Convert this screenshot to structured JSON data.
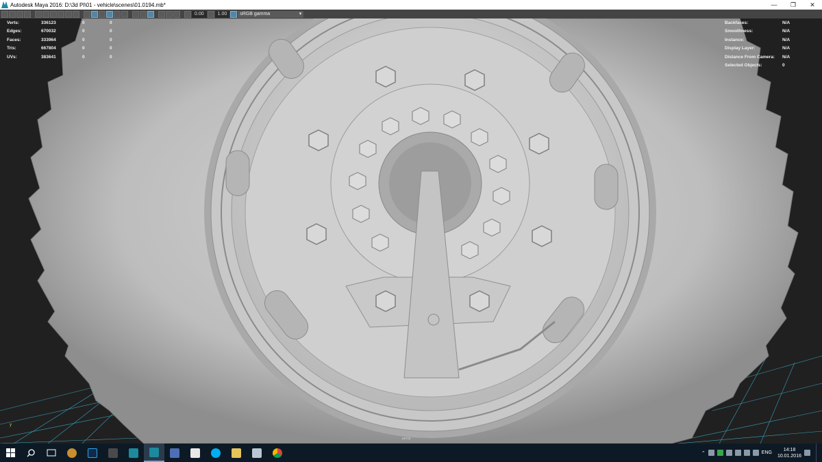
{
  "window": {
    "title": "Autodesk Maya 2016: D:\\3d PI\\01 - vehicle\\scenes\\01.0194.mb*",
    "minimize": "—",
    "restore": "❐",
    "close": "✕"
  },
  "toolbar": {
    "field_1": "0.00",
    "field_2": "1.00",
    "color_space": "sRGB gamma"
  },
  "hud_left": [
    {
      "label": "Verts:",
      "v1": "336123",
      "v2": "0",
      "v3": "0"
    },
    {
      "label": "Edges:",
      "v1": "670032",
      "v2": "0",
      "v3": "0"
    },
    {
      "label": "Faces:",
      "v1": "333964",
      "v2": "0",
      "v3": "0"
    },
    {
      "label": "Tris:",
      "v1": "667804",
      "v2": "0",
      "v3": "0"
    },
    {
      "label": "UVs:",
      "v1": "383641",
      "v2": "0",
      "v3": "0"
    }
  ],
  "hud_right": [
    {
      "label": "Backfaces:",
      "value": "N/A"
    },
    {
      "label": "Smoothness:",
      "value": "N/A"
    },
    {
      "label": "Instance:",
      "value": "N/A"
    },
    {
      "label": "Display Layer:",
      "value": "N/A"
    },
    {
      "label": "Distance From Camera:",
      "value": "N/A"
    },
    {
      "label": "Selected Objects:",
      "value": "0"
    }
  ],
  "viewport": {
    "camera": "persp",
    "axis": "y",
    "grid_color": "#3fc6e8",
    "background": "#202020"
  },
  "taskbar": {
    "apps": [
      "start-icon",
      "search-icon",
      "task-view-icon",
      "paint-icon",
      "photoshop-icon",
      "zbrush-icon",
      "maya-icon",
      "maya-active-icon",
      "save-icon",
      "book-icon",
      "skype-icon",
      "explorer-icon",
      "files-icon",
      "chrome-icon"
    ],
    "language": "ENG",
    "time": "14:18",
    "date": "10.01.2016"
  }
}
